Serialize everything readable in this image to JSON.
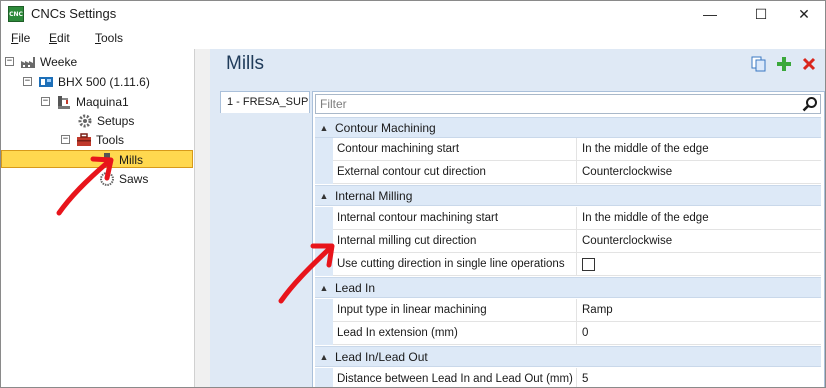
{
  "window": {
    "title": "CNCs Settings",
    "app_icon_text": "CNC",
    "controls": {
      "minimize": "—",
      "maximize": "☐",
      "close": "✕"
    }
  },
  "menu": [
    {
      "label": "File",
      "mnemonic": "F",
      "rest": "ile"
    },
    {
      "label": "Edit",
      "mnemonic": "E",
      "rest": "dit"
    },
    {
      "label": "Tools",
      "mnemonic": "T",
      "rest": "ools"
    }
  ],
  "tree": {
    "nodes": [
      {
        "label": "Weeke",
        "expander": "⊟",
        "icon": "factory-icon"
      },
      {
        "label": "BHX 500 (1.11.6)",
        "expander": "⊟",
        "icon": "machine-icon"
      },
      {
        "label": "Maquina1",
        "expander": "⊟",
        "icon": "cnc-machine-icon"
      },
      {
        "label": "Setups",
        "expander": "",
        "icon": "gear-icon"
      },
      {
        "label": "Tools",
        "expander": "⊟",
        "icon": "toolbox-icon"
      },
      {
        "label": "Mills",
        "expander": "",
        "icon": "mill-icon",
        "selected": true
      },
      {
        "label": "Saws",
        "expander": "",
        "icon": "saw-icon"
      }
    ]
  },
  "panel": {
    "title": "Mills",
    "tab_label": "1 - FRESA_SUP",
    "filter_placeholder": "Filter",
    "actions": [
      "copy-icon",
      "add-icon",
      "delete-icon"
    ]
  },
  "grid": {
    "categories": [
      {
        "label": "Contour Machining",
        "rows": [
          {
            "name": "Contour machining start",
            "value": "In the middle of the edge"
          },
          {
            "name": "External contour cut direction",
            "value": "Counterclockwise"
          }
        ]
      },
      {
        "label": "Internal Milling",
        "rows": [
          {
            "name": "Internal contour machining start",
            "value": "In the middle of the edge"
          },
          {
            "name": "Internal milling cut direction",
            "value": "Counterclockwise"
          },
          {
            "name": "Use cutting direction in single line operations",
            "value": "",
            "checkbox": false
          }
        ]
      },
      {
        "label": "Lead In",
        "rows": [
          {
            "name": "Input type in linear machining",
            "value": "Ramp"
          },
          {
            "name": "Lead In extension (mm)",
            "value": "0"
          }
        ]
      },
      {
        "label": "Lead In/Lead Out",
        "rows": [
          {
            "name": "Distance between Lead In and Lead Out (mm)",
            "value": "5"
          }
        ]
      }
    ]
  },
  "colors": {
    "selection": "#ffd84f",
    "panel_bg": "#dfe9f5",
    "category_bg": "#dde9f7",
    "annotation_arrow": "#e8141b"
  }
}
